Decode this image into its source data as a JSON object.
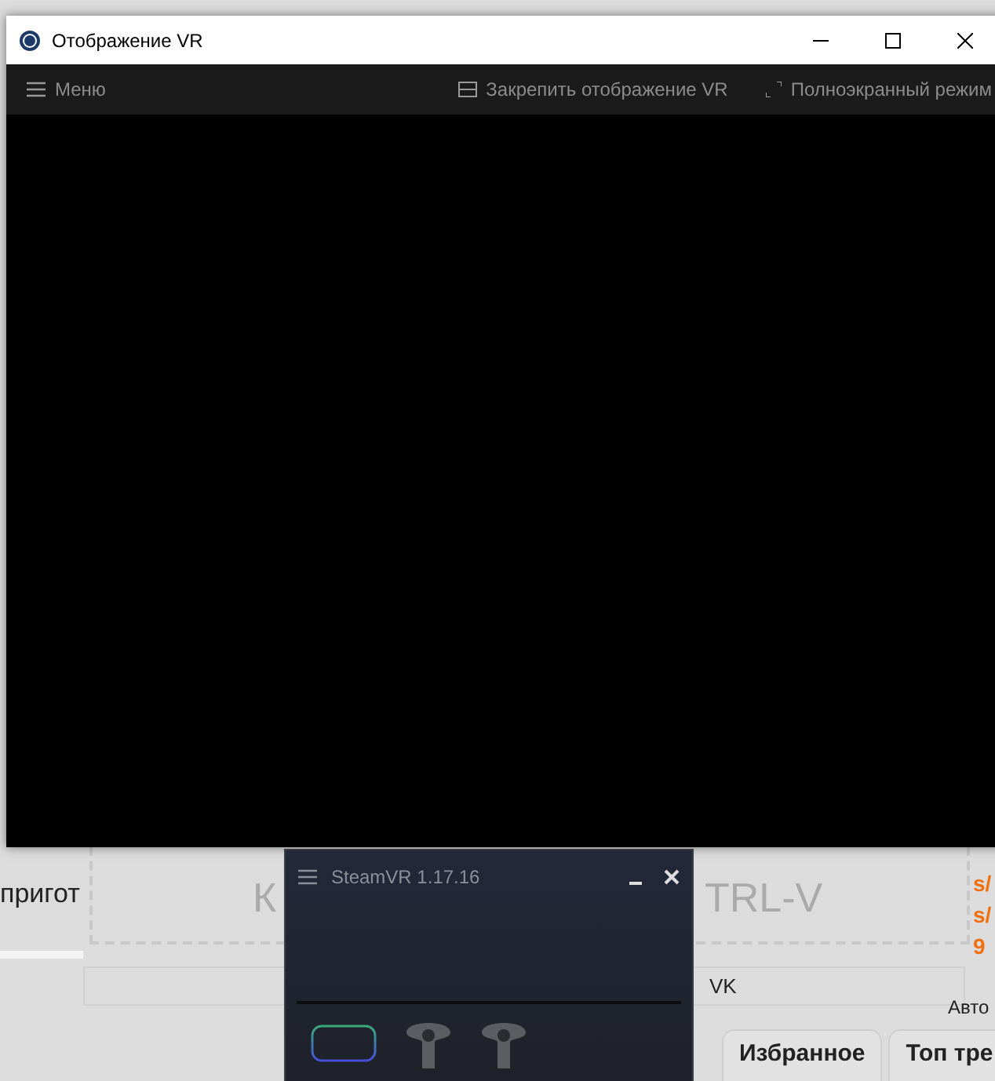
{
  "background_page": {
    "left_text": "пригот",
    "drop_zone": {
      "text_left": "К",
      "text_right": "TRL-V"
    },
    "link_label": "VK",
    "side_label": "Авто",
    "right_links": [
      "s/",
      "s/",
      "9"
    ],
    "tabs": [
      {
        "label": "Избранное"
      },
      {
        "label": "Топ тре"
      }
    ]
  },
  "vr_window": {
    "title": "Отображение VR",
    "toolbar": {
      "menu": "Меню",
      "pin": "Закрепить отображение VR",
      "fullscreen": "Полноэкранный режим"
    }
  },
  "steamvr_window": {
    "title": "SteamVR 1.17.16",
    "devices": [
      {
        "kind": "headset"
      },
      {
        "kind": "controller"
      },
      {
        "kind": "controller"
      }
    ]
  }
}
